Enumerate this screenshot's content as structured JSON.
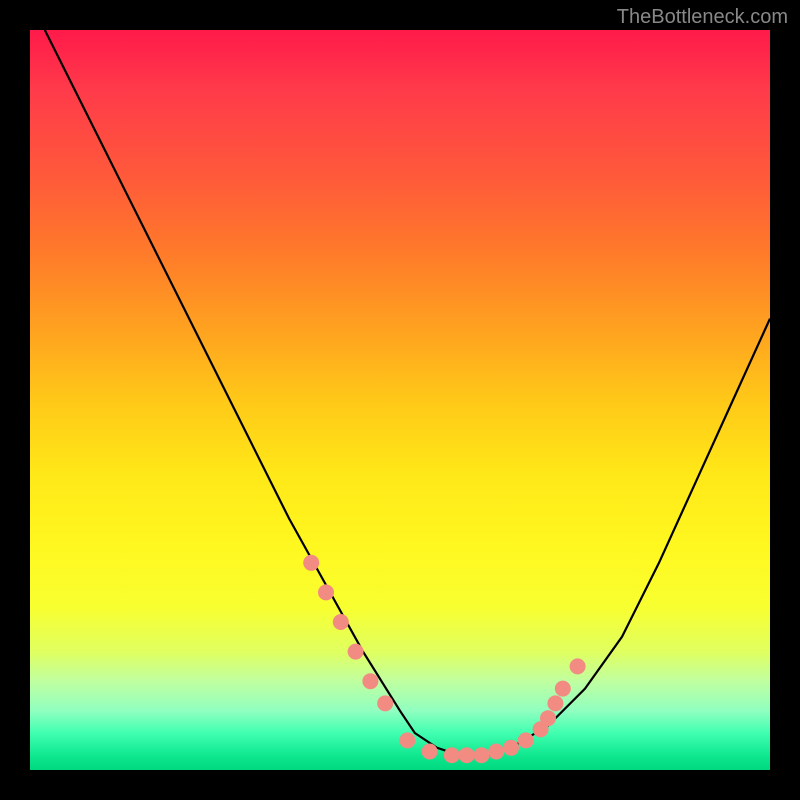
{
  "watermark": "TheBottleneck.com",
  "chart_data": {
    "type": "line",
    "title": "",
    "xlabel": "",
    "ylabel": "",
    "xlim": [
      0,
      100
    ],
    "ylim": [
      0,
      100
    ],
    "series": [
      {
        "name": "curve",
        "x": [
          2,
          5,
          10,
          15,
          20,
          25,
          30,
          35,
          40,
          45,
          50,
          52,
          55,
          58,
          62,
          65,
          70,
          75,
          80,
          85,
          90,
          95,
          100
        ],
        "values": [
          100,
          94,
          84,
          74,
          64,
          54,
          44,
          34,
          25,
          16,
          8,
          5,
          3,
          2,
          2,
          3,
          6,
          11,
          18,
          28,
          39,
          50,
          61
        ]
      }
    ],
    "highlight_points": {
      "name": "dots",
      "color": "#f28b82",
      "x": [
        38,
        40,
        42,
        44,
        46,
        48,
        51,
        54,
        57,
        59,
        61,
        63,
        65,
        67,
        69,
        70,
        71,
        72,
        74
      ],
      "values": [
        28,
        24,
        20,
        16,
        12,
        9,
        4,
        2.5,
        2,
        2,
        2,
        2.5,
        3,
        4,
        5.5,
        7,
        9,
        11,
        14
      ]
    },
    "gradient_stops": [
      {
        "pos": 0,
        "color": "#ff1a4a"
      },
      {
        "pos": 20,
        "color": "#ff5a3a"
      },
      {
        "pos": 40,
        "color": "#ffa020"
      },
      {
        "pos": 60,
        "color": "#ffe818"
      },
      {
        "pos": 80,
        "color": "#e0ff60"
      },
      {
        "pos": 95,
        "color": "#40ffb0"
      },
      {
        "pos": 100,
        "color": "#00d880"
      }
    ]
  }
}
